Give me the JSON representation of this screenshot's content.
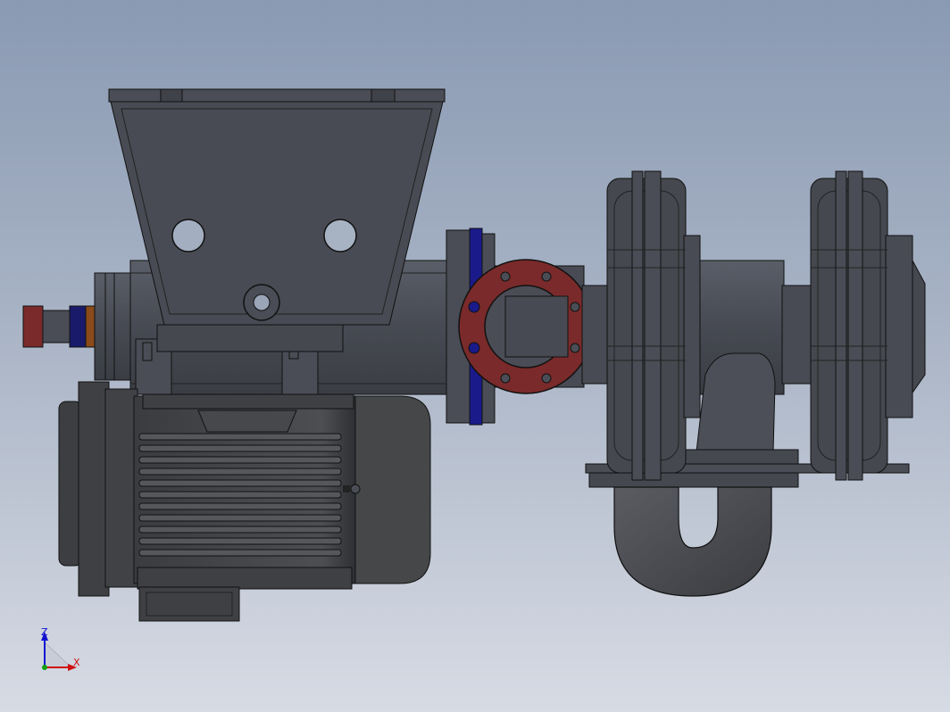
{
  "app": {
    "view": "cad-3d-viewport"
  },
  "triad": {
    "z_label": "Z",
    "x_label": "X",
    "z_color": "#1010d0",
    "x_color": "#d01010",
    "origin_color": "#10a010"
  },
  "colors": {
    "background_top": "#8a9ab3",
    "background_bottom": "#d7dbe4",
    "body_gray": "#4a4d55",
    "body_edge": "#111111",
    "flange_red": "#7a2a2a",
    "gasket_blue": "#1a1a8a",
    "bearing_orange": "#8a4a1a"
  },
  "model": {
    "parts": [
      "hopper",
      "shaft-coupling",
      "main-barrel",
      "inlet-flange",
      "pump-discharge-housing",
      "impeller-stage-left",
      "impeller-stage-right",
      "u-bend-pipe",
      "electric-motor",
      "motor-terminal-box"
    ]
  }
}
